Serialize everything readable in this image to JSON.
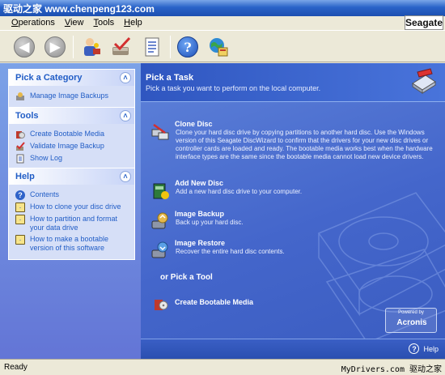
{
  "window": {
    "title": "驱动之家 www.chenpeng123.com"
  },
  "menu": [
    {
      "label": "Operations",
      "underline": "O",
      "rest": "perations"
    },
    {
      "label": "View",
      "underline": "V",
      "rest": "iew"
    },
    {
      "label": "Tools",
      "underline": "T",
      "rest": "ools"
    },
    {
      "label": "Help",
      "underline": "H",
      "rest": "elp"
    }
  ],
  "brand": "Seagate",
  "toolbar": {
    "icons": [
      "back-arrow-icon",
      "forward-arrow-icon",
      "wizard-icon",
      "check-disc-icon",
      "log-document-icon",
      "help-icon",
      "web-link-icon"
    ]
  },
  "sidebar": {
    "pick_category": {
      "title": "Pick a Category",
      "items": [
        {
          "label": "Manage Image Backups",
          "icon": "backup-icon"
        }
      ]
    },
    "tools": {
      "title": "Tools",
      "items": [
        {
          "label": "Create Bootable Media",
          "icon": "bootable-media-icon"
        },
        {
          "label": "Validate Image Backup",
          "icon": "validate-icon"
        },
        {
          "label": "Show Log",
          "underline": "L",
          "icon": "log-icon"
        }
      ]
    },
    "help": {
      "title": "Help",
      "items": [
        {
          "label": "Contents",
          "icon": "help-icon"
        },
        {
          "label": "How to clone your disc drive",
          "icon": "help-topic-icon"
        },
        {
          "label": "How to partition and format your data drive",
          "icon": "help-topic-icon"
        },
        {
          "label": "How to make a bootable version of this software",
          "icon": "help-topic-icon"
        }
      ]
    }
  },
  "main": {
    "title": "Pick a Task",
    "subtitle": "Pick a task you want to perform on the local computer.",
    "tasks": [
      {
        "name": "Clone Disc",
        "icon": "clone-disc-icon",
        "description": "Clone your hard disc drive by copying partitions to another hard disc. Use the Windows version of this Seagate DiscWizard to confirm that the drivers for your new disc drives or controller cards are loaded and ready. The bootable media works best when the hardware interface types are the same since the bootable media cannot load new device drivers."
      },
      {
        "name": "Add New Disc",
        "icon": "add-disc-icon",
        "description": "Add a new hard disc drive to your computer."
      },
      {
        "name": "Image Backup",
        "icon": "image-backup-icon",
        "description": "Back up your hard disc."
      },
      {
        "name": "Image Restore",
        "icon": "image-restore-icon",
        "description": "Recover the entire hard disc contents."
      }
    ],
    "or_tool": "or Pick a Tool",
    "tool": {
      "name": "Create Bootable Media",
      "icon": "bootable-media-icon"
    },
    "powered_by": "Powered by",
    "powered_brand": "Acronis",
    "help_label": "Help"
  },
  "status": {
    "text": "Ready",
    "watermark": "MyDrivers.com 驱动之家"
  },
  "colors": {
    "accent": "#215dc6",
    "pane_blue": "#4466cb",
    "titlebar": "#2a63c8"
  }
}
